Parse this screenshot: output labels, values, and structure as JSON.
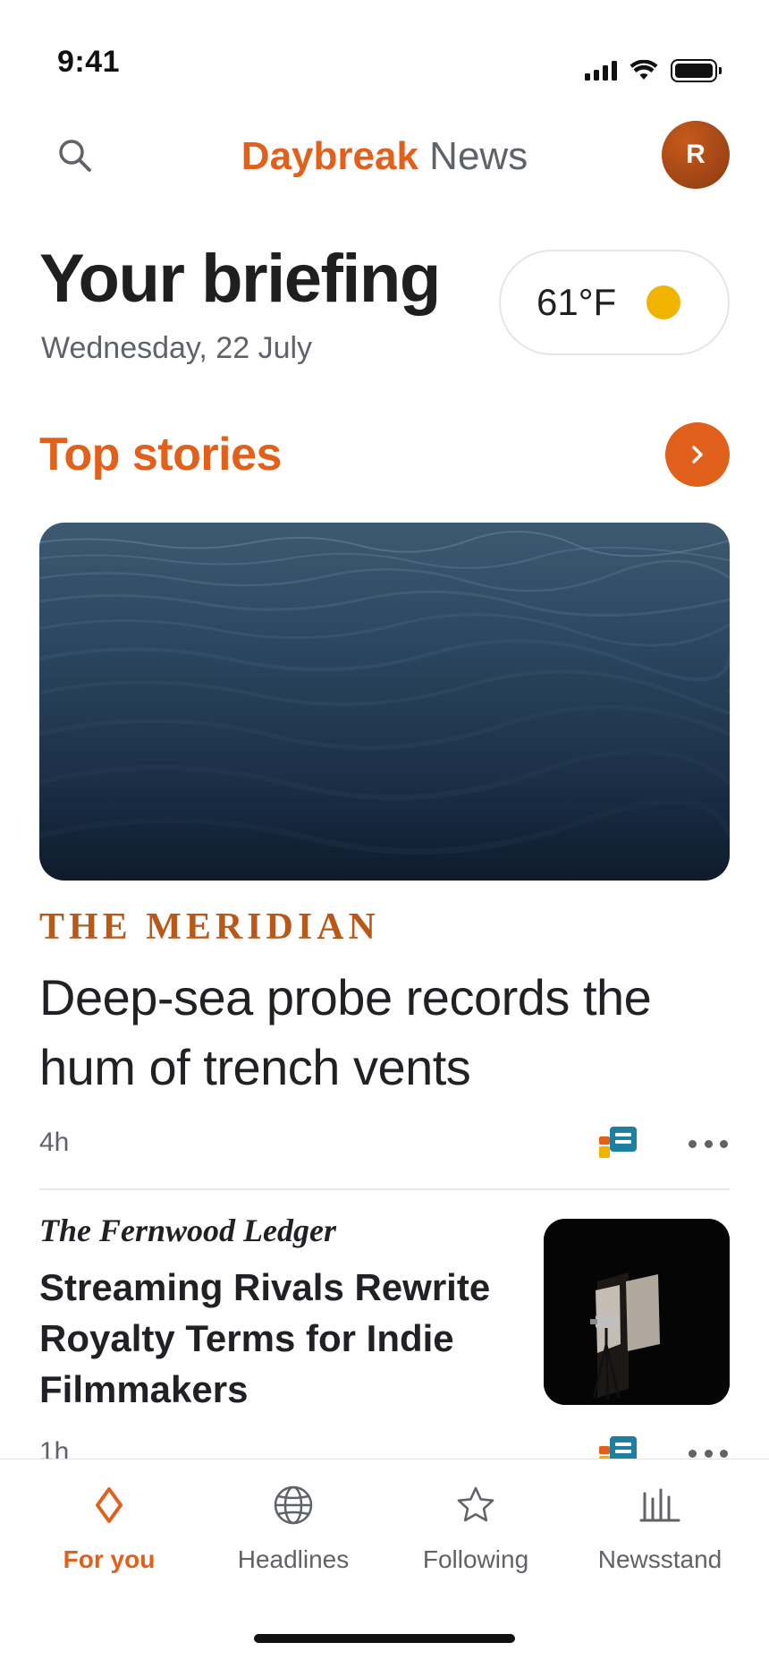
{
  "status_bar": {
    "time": "9:41"
  },
  "header": {
    "title_brand": "Daybreak",
    "title_suffix": "News",
    "avatar_initial": "R"
  },
  "briefing": {
    "title": "Your briefing",
    "date": "Wednesday, 22 July",
    "weather": {
      "temperature": "61°F",
      "icon": "sun-icon"
    }
  },
  "top_stories": {
    "section_title": "Top stories",
    "articles": [
      {
        "source": "THE MERIDIAN",
        "headline": "Deep-sea probe records the hum of trench vents",
        "time": "4h",
        "image": "dark ocean waves"
      },
      {
        "source": "The Fernwood Ledger",
        "headline": "Streaming Rivals Rewrite Royalty Terms for Indie Filmmakers",
        "time": "1h",
        "image": "camera on tripod in dark room"
      }
    ]
  },
  "bottom_nav": {
    "items": [
      {
        "label": "For you",
        "icon": "diamond-icon",
        "active": true
      },
      {
        "label": "Headlines",
        "icon": "globe-icon",
        "active": false
      },
      {
        "label": "Following",
        "icon": "star-icon",
        "active": false
      },
      {
        "label": "Newsstand",
        "icon": "newsstand-icon",
        "active": false
      }
    ]
  },
  "colors": {
    "accent": "#e0601c",
    "meridian_source": "#b8591a",
    "sun": "#f0b400",
    "secondary_text": "#5f6368"
  }
}
